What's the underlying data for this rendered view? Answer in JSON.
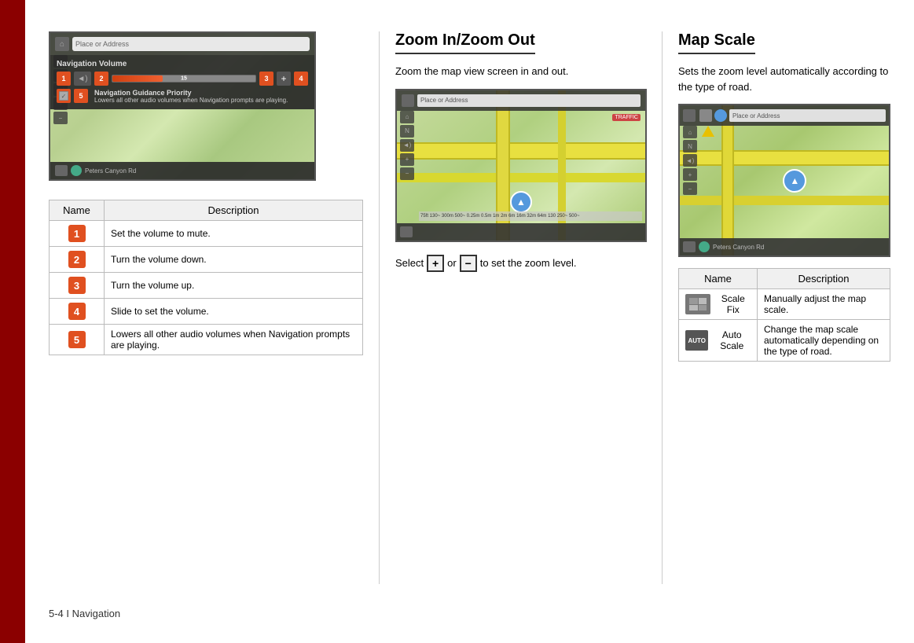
{
  "page": {
    "footer": "5-4 I Navigation",
    "left_bar_color": "#8b0000"
  },
  "left_section": {
    "screenshot": {
      "top_bar": {
        "address_placeholder": "Place or Address"
      },
      "volume_overlay": {
        "title": "Navigation Volume",
        "slider_value": "15",
        "badge_mute": "1",
        "badge_down": "2",
        "badge_up": "3",
        "badge_slide": "4",
        "badge_guidance": "5"
      },
      "bottom_bar": {
        "location": "Peters Canyon Rd"
      }
    },
    "table": {
      "col_name": "Name",
      "col_description": "Description",
      "rows": [
        {
          "badge": "1",
          "description": "Set the volume to mute."
        },
        {
          "badge": "2",
          "description": "Turn the volume down."
        },
        {
          "badge": "3",
          "description": "Turn the volume up."
        },
        {
          "badge": "4",
          "description": "Slide to set the volume."
        },
        {
          "badge": "5",
          "description": "Lowers all other audio volumes when Navigation prompts are playing."
        }
      ]
    }
  },
  "middle_section": {
    "title": "Zoom In/Zoom Out",
    "description": "Zoom the map view screen in and out.",
    "screenshot": {
      "address_placeholder": "Place or Address",
      "traffic_label": "TRAFFIC"
    },
    "select_text_before": "Select",
    "select_text_middle": "or",
    "select_text_after": "to set the zoom level.",
    "plus_label": "+",
    "minus_label": "−"
  },
  "right_section": {
    "title": "Map Scale",
    "description": "Sets the zoom level automatically according to the type of road.",
    "screenshot": {
      "address_placeholder": "Place or Address",
      "location": "Peters Canyon Rd"
    },
    "table": {
      "col_name": "Name",
      "col_description": "Description",
      "rows": [
        {
          "icon_label": "Scale Fix",
          "name_text": "Scale Fix",
          "description": "Manually adjust the map scale."
        },
        {
          "icon_label": "Auto",
          "name_text": "Auto Scale",
          "description": "Change the map scale automatically depending on the type of road."
        }
      ]
    }
  }
}
